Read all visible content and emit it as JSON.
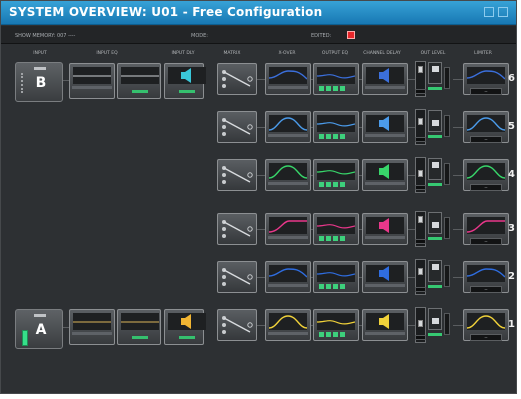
{
  "window": {
    "title": "SYSTEM OVERVIEW: U01 - Free Configuration",
    "accent": "#1f87c2"
  },
  "infobar": {
    "label_memory": "SHOW MEMORY: 007 ----",
    "label_mode": "MODE:",
    "label_edited": "EDITED:"
  },
  "columns": [
    "INPUT",
    "INPUT EQ",
    "INPUT DLY",
    "MATRIX",
    "X-OVER",
    "OUTPUT EQ",
    "CHANNEL DELAY",
    "OUT LEVEL",
    "LIMITER"
  ],
  "inputs": [
    {
      "name": "B"
    },
    {
      "name": "A"
    }
  ],
  "outputs": [
    {
      "num": "6",
      "name": "--",
      "xover": "lp",
      "color": "#3b6fdc"
    },
    {
      "num": "5",
      "name": "--",
      "xover": "bp",
      "color": "#4b9bea"
    },
    {
      "num": "4",
      "name": "--",
      "xover": "bp",
      "color": "#38d66a"
    },
    {
      "num": "3",
      "name": "--",
      "xover": "hp",
      "color": "#e8378a"
    },
    {
      "num": "2",
      "name": "--",
      "xover": "lp",
      "color": "#2f6de0"
    },
    {
      "num": "1",
      "name": "--",
      "xover": "bp",
      "color": "#f1d23a"
    }
  ],
  "icons": [
    "speaker-icon",
    "fader-icon",
    "gain-knob-icon",
    "matrix-route-icon"
  ]
}
